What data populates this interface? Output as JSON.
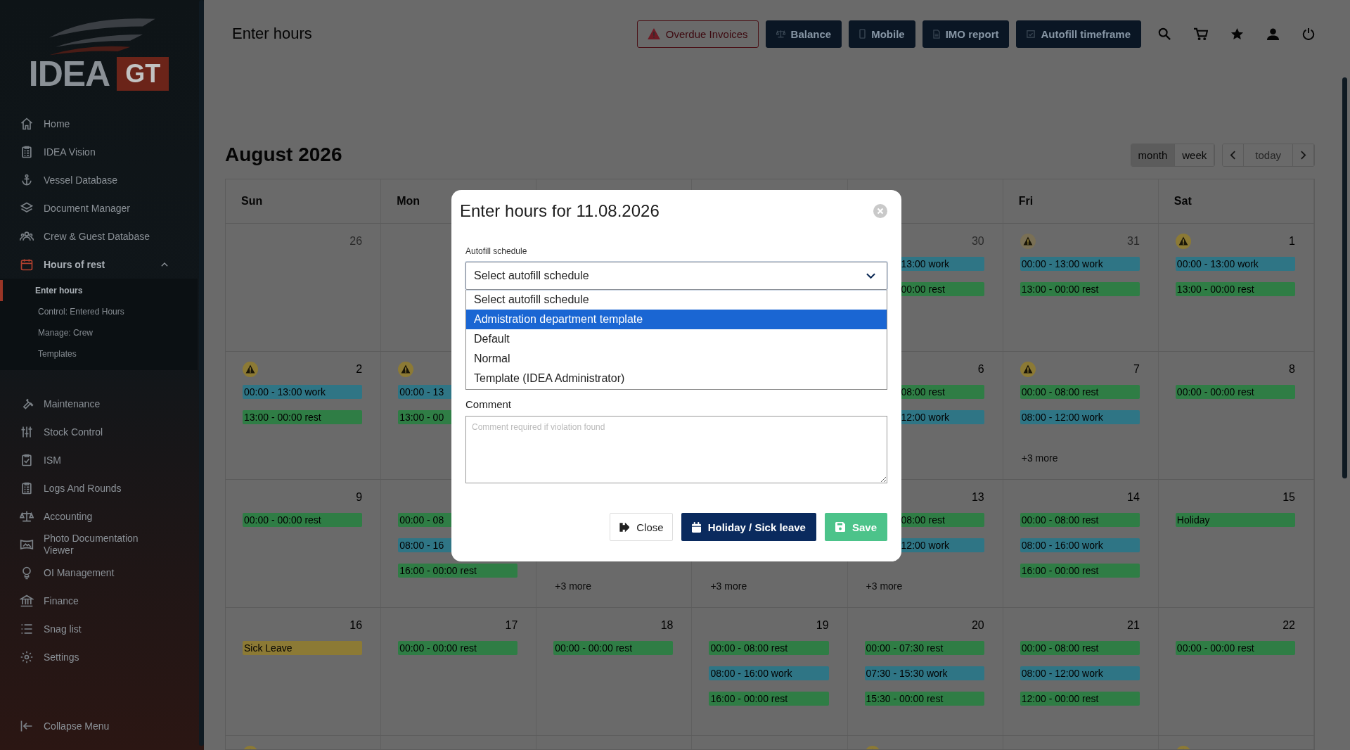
{
  "sidebar": {
    "logo": {
      "word": "IDEA",
      "badge": "GT"
    },
    "groups": [
      [
        {
          "label": "Home",
          "selected": false
        },
        {
          "label": "IDEA Vision",
          "selected": false
        },
        {
          "label": "Vessel Database",
          "selected": false
        },
        {
          "label": "Document Manager",
          "selected": false
        },
        {
          "label": "Crew & Guest Database",
          "selected": false
        },
        {
          "label": "Hours of rest",
          "selected": true,
          "expanded": true,
          "children": [
            {
              "label": "Enter hours",
              "selected": true
            },
            {
              "label": "Control: Entered Hours",
              "selected": false
            },
            {
              "label": "Manage: Crew",
              "selected": false
            },
            {
              "label": "Templates",
              "selected": false
            }
          ]
        }
      ],
      [
        {
          "label": "Maintenance",
          "selected": false
        },
        {
          "label": "Stock Control",
          "selected": false
        },
        {
          "label": "ISM",
          "selected": false
        },
        {
          "label": "Logs And Rounds",
          "selected": false
        },
        {
          "label": "Accounting",
          "selected": false
        },
        {
          "label": "Photo Documentation Viewer",
          "selected": false
        },
        {
          "label": "OI Management",
          "selected": false
        },
        {
          "label": "Finance",
          "selected": false
        },
        {
          "label": "Snag list",
          "selected": false
        },
        {
          "label": "Settings",
          "selected": false
        }
      ]
    ],
    "collapse": "Collapse Menu"
  },
  "topbar": {
    "title": "Enter hours",
    "buttons": [
      {
        "label": "Overdue Invoices",
        "kind": "warning"
      },
      {
        "label": "Balance",
        "kind": "balance"
      },
      {
        "label": "Mobile",
        "kind": "mobile"
      },
      {
        "label": "IMO report",
        "kind": "report"
      },
      {
        "label": "Autofill timeframe",
        "kind": "autofill"
      }
    ]
  },
  "calendar": {
    "title": "August 2026",
    "views": [
      {
        "label": "month",
        "selected": true
      },
      {
        "label": "week",
        "selected": false
      }
    ],
    "today": {
      "label": "today",
      "disabled": true
    },
    "headers": {
      "sun": "Sun",
      "mon": "Mon",
      "fri": "Fri",
      "sat": "Sat"
    },
    "weeks": [
      {
        "sun": {
          "day": "26",
          "outside": true
        },
        "thu": {
          "day": "30",
          "outside": true,
          "events": [
            {
              "text": "13:00 work",
              "kind": "work",
              "covered": true
            },
            {
              "text": "00:00 rest",
              "kind": "rest",
              "covered": true
            }
          ]
        },
        "fri": {
          "day": "31",
          "outside": true,
          "warning": true,
          "events": [
            {
              "text": "00:00 - 13:00 work",
              "kind": "work"
            },
            {
              "text": "13:00 - 00:00 rest",
              "kind": "rest"
            }
          ]
        },
        "sat": {
          "day": "1",
          "outside": false,
          "warning": true,
          "events": [
            {
              "text": "00:00 - 13:00 work",
              "kind": "work"
            },
            {
              "text": "13:00 - 00:00 rest",
              "kind": "rest"
            }
          ]
        }
      },
      {
        "sun": {
          "day": "2",
          "warning": true,
          "events": [
            {
              "text": "00:00 - 13:00 work",
              "kind": "work"
            },
            {
              "text": "13:00 - 00:00 rest",
              "kind": "rest"
            }
          ]
        },
        "mon": {
          "warning": true,
          "events": [
            {
              "text": "00:00 - 13",
              "kind": "work"
            },
            {
              "text": "13:00 - 00",
              "kind": "rest"
            }
          ]
        },
        "thu": {
          "day": "6",
          "events": [
            {
              "text": "08:00 rest",
              "kind": "rest",
              "covered": true
            },
            {
              "text": "12:00 work",
              "kind": "work",
              "covered": true
            }
          ]
        },
        "fri": {
          "day": "7",
          "warning": true,
          "events": [
            {
              "text": "00:00 - 08:00 rest",
              "kind": "rest"
            },
            {
              "text": "08:00 - 12:00 work",
              "kind": "work"
            }
          ],
          "more": "+3 more"
        },
        "sat": {
          "day": "8",
          "events": [
            {
              "text": "00:00 - 00:00 rest",
              "kind": "rest"
            }
          ]
        }
      },
      {
        "sun": {
          "day": "9",
          "events": [
            {
              "text": "00:00 - 00:00 rest",
              "kind": "rest"
            }
          ]
        },
        "mon": {
          "events": [
            {
              "text": "00:00 - 08",
              "kind": "rest"
            },
            {
              "text": "08:00 - 16",
              "kind": "work"
            },
            {
              "text": "16:00 - 00:00 rest",
              "kind": "rest"
            }
          ]
        },
        "tue": {
          "more": "+3 more"
        },
        "wed": {
          "more": "+3 more"
        },
        "thu": {
          "day": "13",
          "events": [
            {
              "text": "08:00 rest",
              "kind": "rest",
              "covered": true
            },
            {
              "text": "12:00 work",
              "kind": "work",
              "covered": true
            }
          ],
          "more": "+3 more"
        },
        "fri": {
          "day": "14",
          "events": [
            {
              "text": "00:00 - 08:00 rest",
              "kind": "rest"
            },
            {
              "text": "08:00 - 16:00 work",
              "kind": "work"
            },
            {
              "text": "16:00 - 00:00 rest",
              "kind": "rest"
            }
          ]
        },
        "sat": {
          "day": "15",
          "events": [
            {
              "text": "Holiday",
              "kind": "holiday"
            }
          ]
        }
      },
      {
        "sun": {
          "day": "16",
          "events": [
            {
              "text": "Sick Leave",
              "kind": "sick"
            }
          ]
        },
        "mon": {
          "day": "17",
          "events": [
            {
              "text": "00:00 - 00:00 rest",
              "kind": "rest"
            }
          ]
        },
        "tue": {
          "day": "18",
          "events": [
            {
              "text": "00:00 - 00:00 rest",
              "kind": "rest"
            }
          ]
        },
        "wed": {
          "day": "19",
          "events": [
            {
              "text": "00:00 - 08:00 rest",
              "kind": "rest"
            },
            {
              "text": "08:00 - 16:00 work",
              "kind": "work"
            },
            {
              "text": "16:00 - 00:00 rest",
              "kind": "rest"
            }
          ]
        },
        "thu": {
          "day": "20",
          "events": [
            {
              "text": "00:00 - 07:30 rest",
              "kind": "rest"
            },
            {
              "text": "07:30 - 15:30 work",
              "kind": "work"
            },
            {
              "text": "15:30 - 00:00 rest",
              "kind": "rest"
            }
          ]
        },
        "fri": {
          "day": "21",
          "events": [
            {
              "text": "00:00 - 08:00 rest",
              "kind": "rest"
            },
            {
              "text": "08:00 - 12:00 work",
              "kind": "work"
            },
            {
              "text": "12:00 - 00:00 rest",
              "kind": "rest"
            }
          ]
        },
        "sat": {
          "day": "22",
          "events": [
            {
              "text": "00:00 - 00:00 rest",
              "kind": "rest"
            }
          ]
        }
      },
      {
        "sun": {
          "warning": true
        },
        "thu": {
          "warning": true
        },
        "sat": {
          "warning": true
        }
      }
    ]
  },
  "modal": {
    "title": "Enter hours for 11.08.2026",
    "autofill_label": "Autofill schedule",
    "select_value": "Select autofill schedule",
    "options": [
      {
        "label": "Select autofill schedule",
        "selected": false
      },
      {
        "label": "Admistration department template",
        "selected": true
      },
      {
        "label": "Default",
        "selected": false
      },
      {
        "label": "Normal",
        "selected": false
      },
      {
        "label": "Template (IDEA Administrator)",
        "selected": false
      }
    ],
    "comment_label": "Comment",
    "comment_placeholder": "Comment required if violation found",
    "buttons": [
      {
        "label": "Close",
        "kind": "close"
      },
      {
        "label": "Holiday / Sick leave",
        "kind": "holiday"
      },
      {
        "label": "Save",
        "kind": "save"
      }
    ]
  }
}
